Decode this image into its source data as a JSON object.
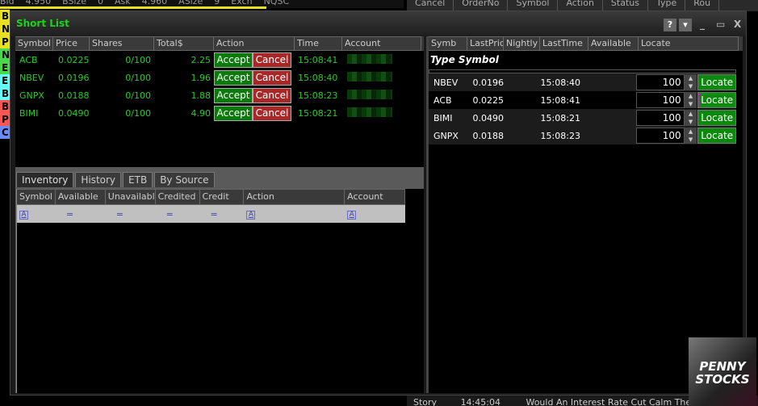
{
  "background": {
    "quote_bar": [
      "Bid",
      "4.950",
      "BSize",
      "0",
      "Ask",
      "4.960",
      "ASize",
      "9",
      "Exch",
      "NQSC"
    ],
    "side_letters": [
      "B",
      "N",
      "P",
      "N",
      "E",
      "E",
      "B",
      "B",
      "P",
      "C"
    ],
    "orders_header": [
      "Cancel",
      "OrderNo",
      "Symbol",
      "Action",
      "Status",
      "Type",
      "Rou"
    ],
    "news": {
      "type": "Story",
      "time": "14:45:04",
      "headline": "Would An Interest Rate Cut Calm The Stock..."
    }
  },
  "window": {
    "title": "Short List",
    "help": "?",
    "menu": "▾",
    "minimize": "_",
    "maximize": "▭",
    "close": "X"
  },
  "short_list": {
    "columns": [
      "Symbol",
      "Price",
      "Shares",
      "Total$",
      "Action",
      "Time",
      "Account"
    ],
    "accept_label": "Accept",
    "cancel_label": "Cancel",
    "rows": [
      {
        "symbol": "ACB",
        "price": "0.0225",
        "shares": "0/100",
        "total": "2.25",
        "time": "15:08:41"
      },
      {
        "symbol": "NBEV",
        "price": "0.0196",
        "shares": "0/100",
        "total": "1.96",
        "time": "15:08:40"
      },
      {
        "symbol": "GNPX",
        "price": "0.0188",
        "shares": "0/100",
        "total": "1.88",
        "time": "15:08:23"
      },
      {
        "symbol": "BIMI",
        "price": "0.0490",
        "shares": "0/100",
        "total": "4.90",
        "time": "15:08:21"
      }
    ]
  },
  "inventory": {
    "tabs": [
      "Inventory",
      "History",
      "ETB",
      "By Source"
    ],
    "active_tab": "Inventory",
    "columns": [
      "Symbol",
      "Available",
      "Unavailable",
      "Credited",
      "Credit",
      "Action",
      "Account"
    ],
    "filter_row": [
      "A",
      "=",
      "=",
      "=",
      "=",
      "A",
      "A"
    ]
  },
  "locate": {
    "columns": [
      "Symb",
      "LastPric",
      "Nightly",
      "LastTime",
      "Available",
      "Locate"
    ],
    "type_symbol_label": "Type Symbol",
    "locate_label": "Locate",
    "rows": [
      {
        "symbol": "NBEV",
        "last": "0.0196",
        "time": "15:08:40",
        "qty": "100"
      },
      {
        "symbol": "ACB",
        "last": "0.0225",
        "time": "15:08:41",
        "qty": "100"
      },
      {
        "symbol": "BIMI",
        "last": "0.0490",
        "time": "15:08:21",
        "qty": "100"
      },
      {
        "symbol": "GNPX",
        "last": "0.0188",
        "time": "15:08:23",
        "qty": "100"
      }
    ]
  },
  "ad": {
    "text": "PENNY STOCKS"
  },
  "colors": {
    "accent_green": "#1fd11f",
    "accept": "#0a7a0a",
    "cancel": "#a82828",
    "locate": "#0a8a0a"
  }
}
